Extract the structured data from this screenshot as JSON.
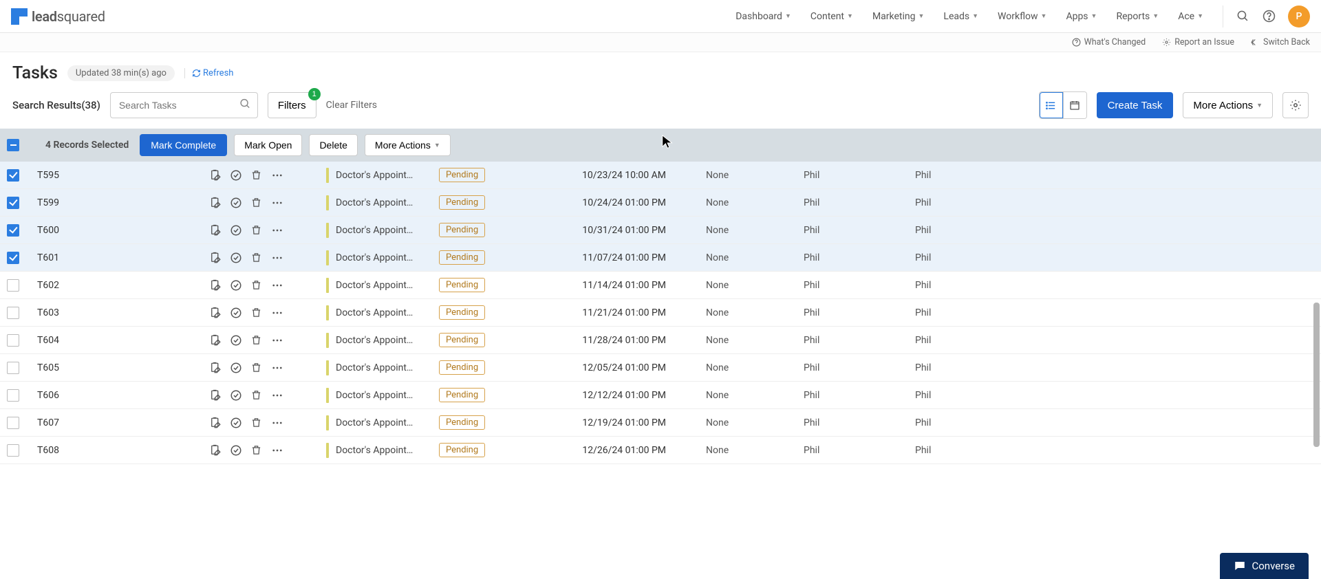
{
  "brand": {
    "name_part1": "lead",
    "name_part2": "squared"
  },
  "nav": {
    "items": [
      "Dashboard",
      "Content",
      "Marketing",
      "Leads",
      "Workflow",
      "Apps",
      "Reports",
      "Ace"
    ]
  },
  "avatar_initial": "P",
  "subbar": {
    "whats_changed": "What's Changed",
    "report_issue": "Report an Issue",
    "switch_back": "Switch Back"
  },
  "page": {
    "title": "Tasks",
    "updated_text": "Updated 38 min(s) ago",
    "refresh_label": "Refresh"
  },
  "toolbar": {
    "results_label": "Search Results(38)",
    "search_placeholder": "Search Tasks",
    "filters_label": "Filters",
    "filters_count": "1",
    "clear_filters": "Clear Filters",
    "create_task": "Create Task",
    "more_actions": "More Actions"
  },
  "selection": {
    "count_text": "4 Records Selected",
    "mark_complete": "Mark Complete",
    "mark_open": "Mark Open",
    "delete": "Delete",
    "more_actions": "More Actions"
  },
  "status_label": "Pending",
  "rows": [
    {
      "id": "T595",
      "type": "Doctor's Appoint…",
      "date": "10/23/24 10:00 AM",
      "priority": "None",
      "owner": "Phil",
      "by": "Phil",
      "checked": true
    },
    {
      "id": "T599",
      "type": "Doctor's Appoint…",
      "date": "10/24/24 01:00 PM",
      "priority": "None",
      "owner": "Phil",
      "by": "Phil",
      "checked": true
    },
    {
      "id": "T600",
      "type": "Doctor's Appoint…",
      "date": "10/31/24 01:00 PM",
      "priority": "None",
      "owner": "Phil",
      "by": "Phil",
      "checked": true
    },
    {
      "id": "T601",
      "type": "Doctor's Appoint…",
      "date": "11/07/24 01:00 PM",
      "priority": "None",
      "owner": "Phil",
      "by": "Phil",
      "checked": true
    },
    {
      "id": "T602",
      "type": "Doctor's Appoint…",
      "date": "11/14/24 01:00 PM",
      "priority": "None",
      "owner": "Phil",
      "by": "Phil",
      "checked": false
    },
    {
      "id": "T603",
      "type": "Doctor's Appoint…",
      "date": "11/21/24 01:00 PM",
      "priority": "None",
      "owner": "Phil",
      "by": "Phil",
      "checked": false
    },
    {
      "id": "T604",
      "type": "Doctor's Appoint…",
      "date": "11/28/24 01:00 PM",
      "priority": "None",
      "owner": "Phil",
      "by": "Phil",
      "checked": false
    },
    {
      "id": "T605",
      "type": "Doctor's Appoint…",
      "date": "12/05/24 01:00 PM",
      "priority": "None",
      "owner": "Phil",
      "by": "Phil",
      "checked": false
    },
    {
      "id": "T606",
      "type": "Doctor's Appoint…",
      "date": "12/12/24 01:00 PM",
      "priority": "None",
      "owner": "Phil",
      "by": "Phil",
      "checked": false
    },
    {
      "id": "T607",
      "type": "Doctor's Appoint…",
      "date": "12/19/24 01:00 PM",
      "priority": "None",
      "owner": "Phil",
      "by": "Phil",
      "checked": false
    },
    {
      "id": "T608",
      "type": "Doctor's Appoint…",
      "date": "12/26/24 01:00 PM",
      "priority": "None",
      "owner": "Phil",
      "by": "Phil",
      "checked": false
    }
  ],
  "converse": "Converse"
}
